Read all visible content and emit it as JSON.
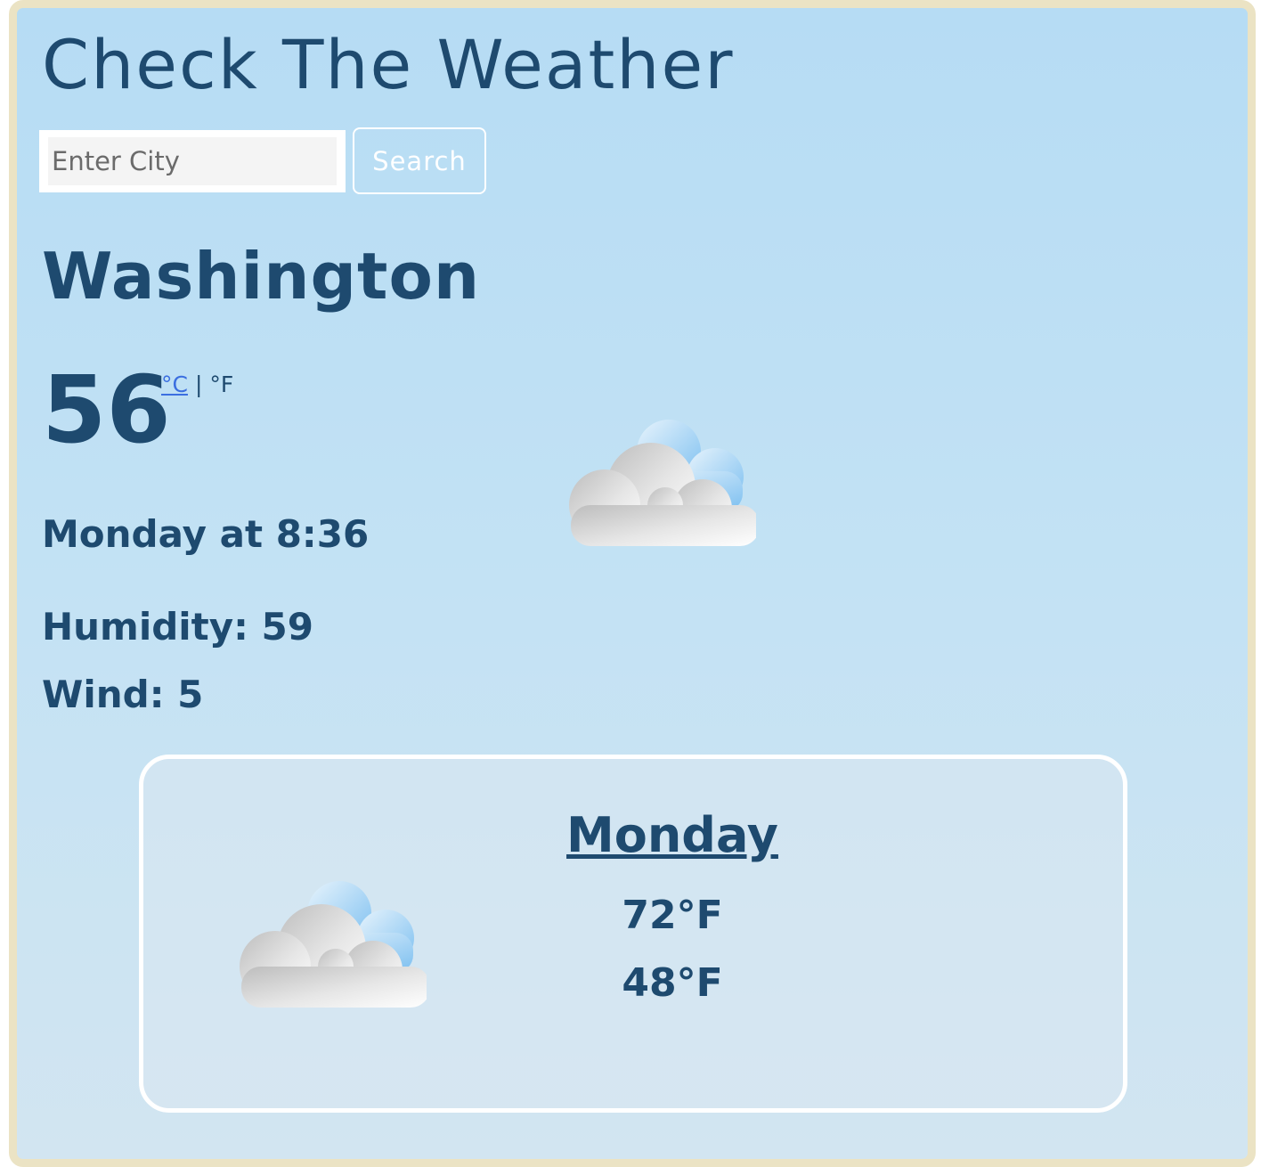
{
  "header": {
    "title": "Check The Weather"
  },
  "search": {
    "placeholder": "Enter City",
    "value": "",
    "button_label": "Search"
  },
  "current": {
    "city": "Washington",
    "temperature": "56",
    "unit_celsius": "°C",
    "unit_separator": "|",
    "unit_fahrenheit": "°F",
    "active_unit": "°C",
    "datetime": "Monday at 8:36",
    "humidity": "Humidity: 59",
    "wind": "Wind: 5",
    "icon": "partly-cloudy-icon"
  },
  "forecast": [
    {
      "day": "Monday",
      "high": "72°F",
      "low": "48°F",
      "icon": "partly-cloudy-icon"
    }
  ],
  "colors": {
    "text": "#1e4a6f",
    "link": "#3b6fe0",
    "frame_border": "#ebe3c4",
    "background_top": "#b6dcf4",
    "background_bottom": "#d2e5f1"
  }
}
